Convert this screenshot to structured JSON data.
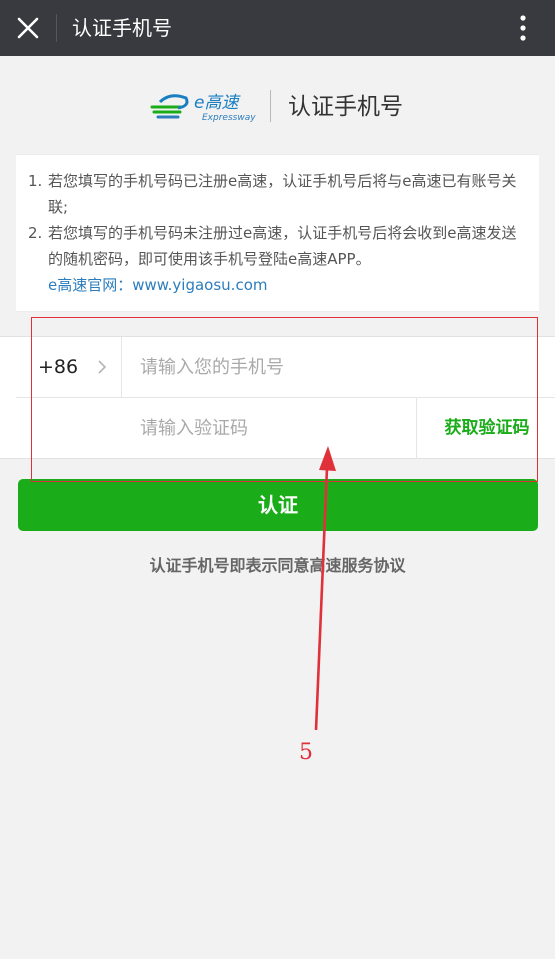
{
  "topbar": {
    "title": "认证手机号",
    "close_icon": "close-icon",
    "more_icon": "more-vertical-icon"
  },
  "brand": {
    "logo_text": "e高速",
    "logo_subtext": "Expressway",
    "title": "认证手机号"
  },
  "notice": {
    "items": [
      {
        "num": "1.",
        "text": "若您填写的手机号码已注册e高速，认证手机号后将与e高速已有账号关联;"
      },
      {
        "num": "2.",
        "text": "若您填写的手机号码未注册过e高速，认证手机号后将会收到e高速发送的随机密码，即可使用该手机号登陆e高速APP。"
      }
    ],
    "link_text": "e高速官网：www.yigaosu.com"
  },
  "form": {
    "country_code": "+86",
    "phone_placeholder": "请输入您的手机号",
    "code_placeholder": "请输入验证码",
    "get_code_label": "获取验证码"
  },
  "submit_label": "认证",
  "agreement_text": "认证手机号即表示同意高速服务协议",
  "annotation": {
    "number": "5"
  },
  "colors": {
    "topbar": "#393a3f",
    "accent_green": "#1aad19",
    "link_blue": "#2c7dbd",
    "annotation_red": "#e0303a",
    "background": "#f2f2f2"
  }
}
